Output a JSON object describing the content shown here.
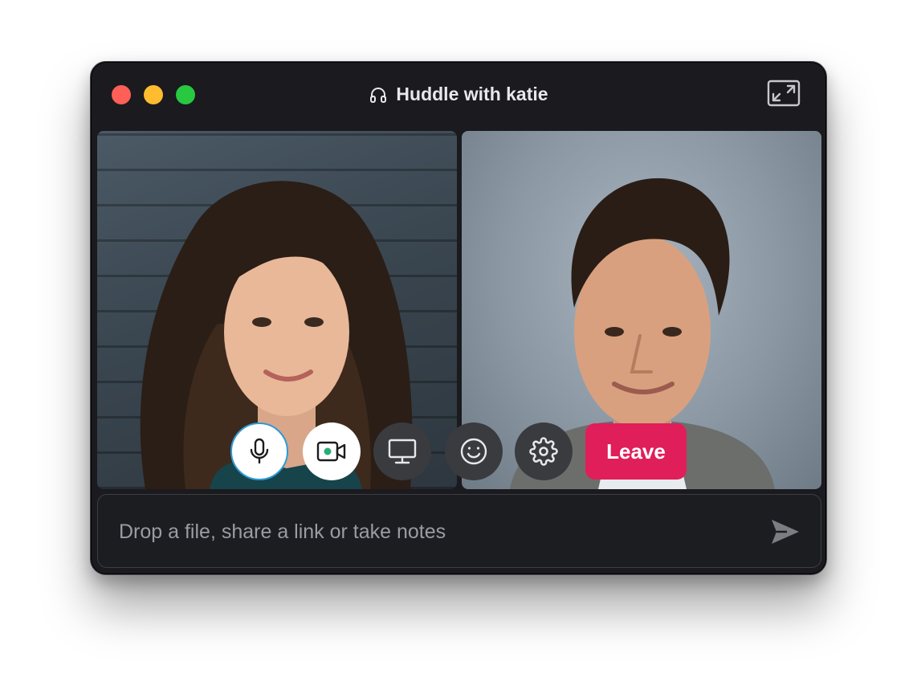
{
  "window": {
    "title": "Huddle with katie",
    "title_icon": "headphones-icon",
    "accent_colors": {
      "close": "#fe5f57",
      "minimize": "#febc2e",
      "maximize": "#28c840",
      "leave": "#e01e5a",
      "mic_ring": "#2d9ad3",
      "video_dot": "#2bac76"
    }
  },
  "participants": [
    {
      "tile": "left",
      "portrait": "woman-portrait"
    },
    {
      "tile": "right",
      "portrait": "man-portrait"
    }
  ],
  "controls": {
    "mic_icon": "microphone-icon",
    "video_icon": "video-camera-icon",
    "screen_icon": "screen-share-icon",
    "emoji_icon": "smiley-icon",
    "settings_icon": "gear-icon",
    "leave_label": "Leave"
  },
  "composer": {
    "placeholder": "Drop a file, share a link or take notes",
    "value": "",
    "send_icon": "send-icon"
  }
}
